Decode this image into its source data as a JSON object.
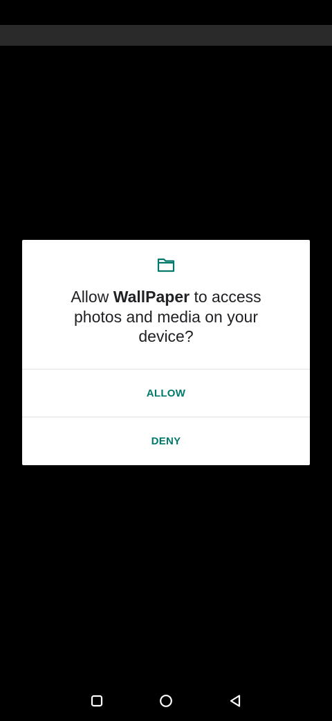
{
  "dialog": {
    "icon": "folder-icon",
    "message_prefix": "Allow ",
    "app_name": "WallPaper",
    "message_suffix": " to access photos and media on your device?",
    "allow_label": "ALLOW",
    "deny_label": "DENY"
  },
  "navigation": {
    "recents_icon": "square-recents-icon",
    "home_icon": "circle-home-icon",
    "back_icon": "triangle-back-icon"
  },
  "colors": {
    "accent": "#00796b",
    "dialog_background": "#ffffff",
    "screen_background": "#000000",
    "toolbar": "#2a2a2a"
  }
}
